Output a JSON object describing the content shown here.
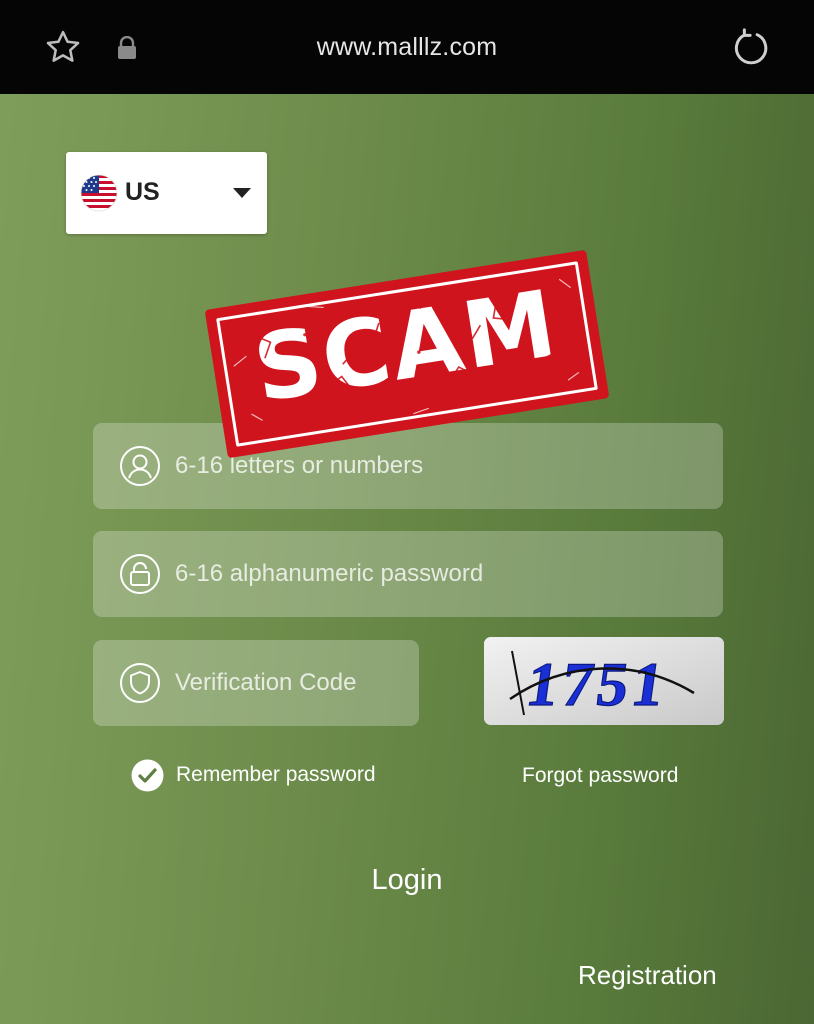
{
  "browser": {
    "url": "www.malllz.com",
    "icons": [
      "star-icon",
      "lock-icon",
      "reload-icon"
    ]
  },
  "country_selector": {
    "code": "US",
    "flag": "us-flag-icon"
  },
  "stamp": {
    "text": "SCAM",
    "color": "#d0141d"
  },
  "form": {
    "username_placeholder": "6-16 letters or numbers",
    "password_placeholder": "6-16 alphanumeric password",
    "code_placeholder": "Verification Code",
    "captcha_text": "1751",
    "remember_label": "Remember password",
    "forgot_label": "Forgot password",
    "login_label": "Login",
    "register_label": "Registration"
  },
  "colors": {
    "background_start": "#7f9d5a",
    "background_end": "#4b6733",
    "field_fill": "rgba(255,255,255,0.25)",
    "captcha_text": "#1a2fd6"
  }
}
